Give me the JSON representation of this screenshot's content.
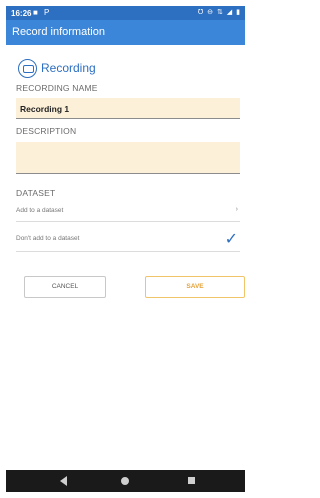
{
  "status_bar": {
    "time": "16:26",
    "left_icons": "■ P",
    "right_icons": "℧ ⊖ ⇅ ◢ ▮"
  },
  "app_bar": {
    "title": "Record information"
  },
  "section": {
    "title": "Recording",
    "icon": "recording-icon"
  },
  "recording_name": {
    "label": "RECORDING NAME",
    "value": "Recording 1"
  },
  "description": {
    "label": "DESCRIPTION",
    "value": ""
  },
  "dataset": {
    "label": "DATASET",
    "options": [
      {
        "text": "Add to a dataset",
        "indicator": "›"
      },
      {
        "text": "Don't add to a dataset",
        "indicator": "✓",
        "selected": true
      }
    ]
  },
  "buttons": {
    "cancel": "CANCEL",
    "save": "SAVE"
  },
  "colors": {
    "primary": "#3b86d8",
    "status": "#2d6fc0",
    "input_bg": "#fdf0d8",
    "save_accent": "#e5a23a"
  }
}
